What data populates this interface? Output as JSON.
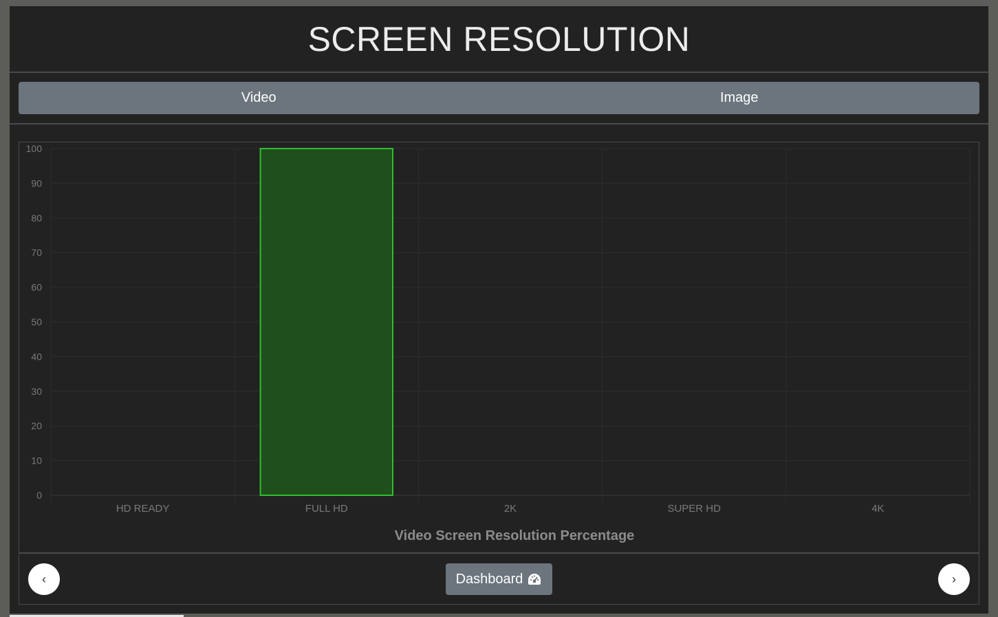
{
  "header": {
    "title": "SCREEN RESOLUTION"
  },
  "tabs": [
    {
      "label": "Video"
    },
    {
      "label": "Image"
    }
  ],
  "chart_data": {
    "type": "bar",
    "categories": [
      "HD READY",
      "FULL HD",
      "2K",
      "SUPER HD",
      "4K"
    ],
    "values": [
      0,
      100,
      0,
      0,
      0
    ],
    "title": "Video Screen Resolution Percentage",
    "xlabel": "",
    "ylabel": "",
    "ylim": [
      0,
      100
    ],
    "yticks": [
      0,
      10,
      20,
      30,
      40,
      50,
      60,
      70,
      80,
      90,
      100
    ],
    "grid": true,
    "bar_fill": "#1f4f1c",
    "bar_border": "#2fbf2f"
  },
  "footer": {
    "prev_label": "‹",
    "next_label": "›",
    "dashboard_label": "Dashboard",
    "dashboard_icon": "tachometer-icon"
  }
}
